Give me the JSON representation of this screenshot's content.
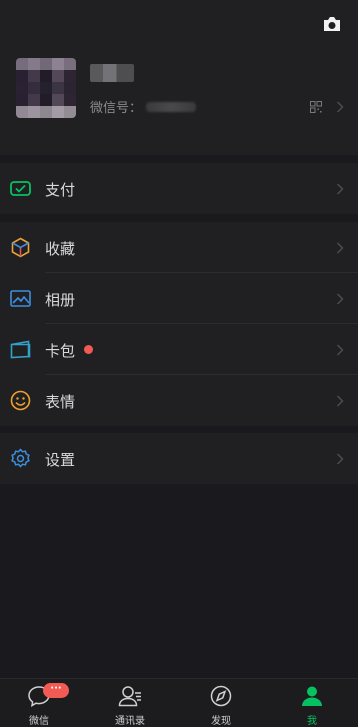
{
  "profile": {
    "nickname": "",
    "wechat_id_label": "微信号："
  },
  "menu": {
    "pay": "支付",
    "favorites": "收藏",
    "album": "相册",
    "cards": "卡包",
    "stickers": "表情",
    "settings": "设置"
  },
  "tabs": [
    {
      "label": "微信",
      "icon": "chat-bubble-icon",
      "badge": "···"
    },
    {
      "label": "通讯录",
      "icon": "contacts-icon"
    },
    {
      "label": "发现",
      "icon": "compass-icon"
    },
    {
      "label": "我",
      "icon": "person-icon"
    }
  ],
  "colors": {
    "accent": "#07c160",
    "badge": "#f25b53",
    "background": "#1a1a1e",
    "panel": "#202022"
  }
}
